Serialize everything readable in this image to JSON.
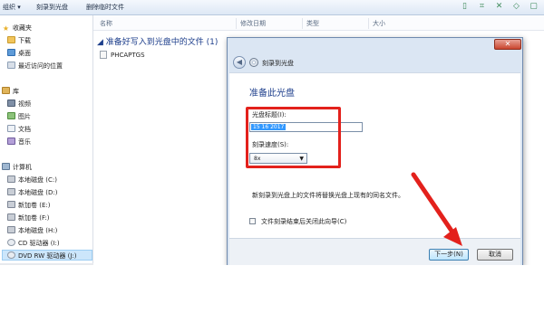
{
  "toolbar": {
    "organize": "组织 ▾",
    "burn": "刻录到光盘",
    "delete_temp": "删除临时文件"
  },
  "columns": {
    "name": "名称",
    "date": "修改日期",
    "type": "类型",
    "size": "大小"
  },
  "nav": {
    "favorites": "收藏夹",
    "downloads": "下载",
    "desktop": "桌面",
    "recent": "最近访问的位置",
    "libraries": "库",
    "videos": "视频",
    "pictures": "图片",
    "documents": "文档",
    "music": "音乐",
    "computer": "计算机",
    "drive_c": "本地磁盘 (C:)",
    "drive_d": "本地磁盘 (D:)",
    "drive_e": "新加卷 (E:)",
    "drive_f": "新加卷 (F:)",
    "drive_h": "本地磁盘 (H:)",
    "drive_i": "CD 驱动器 (I:)",
    "drive_j": "DVD RW 驱动器 (J:)"
  },
  "file_list": {
    "group_title": "准备好写入到光盘中的文件 (1)",
    "files": [
      {
        "name": "PHCAPTGS"
      }
    ]
  },
  "dialog": {
    "close_glyph": "✕",
    "window_title": "刻录到光盘",
    "heading": "准备此光盘",
    "disc_title_label": "光盘标题(I):",
    "disc_title_value": "15 16 2017",
    "speed_label": "刻录速度(S):",
    "speed_value": "8x",
    "info_text": "新刻录到光盘上的文件将替换光盘上现有的同名文件。",
    "close_wizard_label": "文件刻录结束后关闭此向导(C)",
    "next_button": "下一步(N)",
    "cancel_button": "取消"
  },
  "annotation_colors": {
    "highlight_box": "#e3211c",
    "arrow": "#e3211c"
  }
}
